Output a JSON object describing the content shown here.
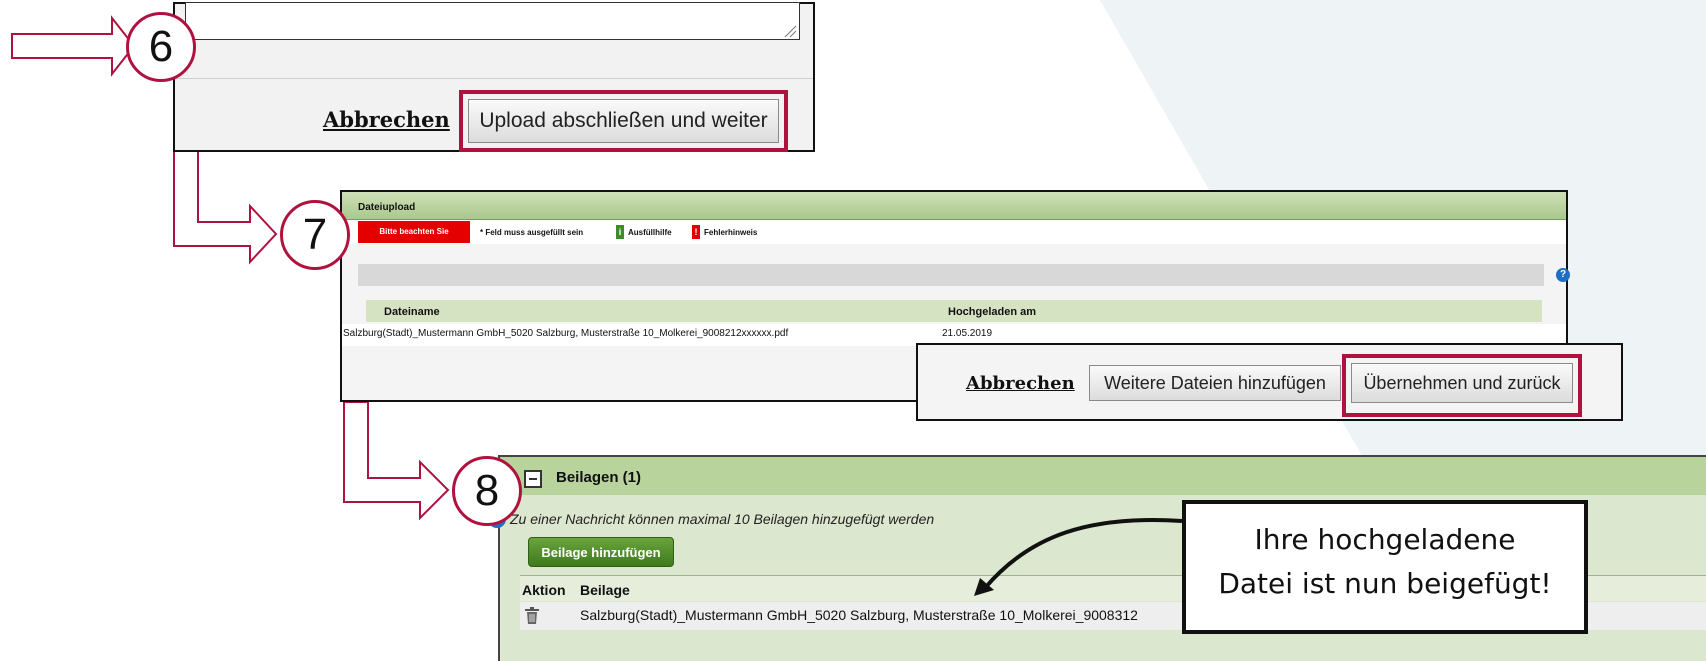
{
  "steps": {
    "step6": "6",
    "step7": "7",
    "step8": "8"
  },
  "panel6": {
    "cancel_label": "Abbrechen",
    "upload_label": "Upload abschließen und weiter"
  },
  "panel7": {
    "title": "Dateiupload",
    "notice_label": "Bitte beachten Sie",
    "legend_required": "* Feld muss ausgefüllt sein",
    "legend_help": "Ausfüllhilfe",
    "legend_error": "Fehlerhinweis",
    "help_icon": "question-circle-icon",
    "table": {
      "columns": [
        "Dateiname",
        "Hochgeladen am"
      ],
      "rows": [
        [
          "Salzburg(Stadt)_Mustermann GmbH_5020 Salzburg, Musterstraße 10_Molkerei_9008212xxxxxx.pdf",
          "21.05.2019"
        ]
      ]
    },
    "dialog": {
      "cancel_label": "Abbrechen",
      "add_more_label": "Weitere Dateien hinzufügen",
      "apply_label": "Übernehmen und zurück"
    }
  },
  "panel8": {
    "title": "Beilagen (1)",
    "info_text": "Zu einer Nachricht können maximal 10 Beilagen hinzugefügt werden",
    "add_button_label": "Beilage hinzufügen",
    "columns": [
      "Aktion",
      "Beilage"
    ],
    "rows": [
      {
        "action_icon": "trash-icon",
        "file": "Salzburg(Stadt)_Mustermann GmbH_5020 Salzburg, Musterstraße 10_Molkerei_9008312"
      }
    ]
  },
  "callout": {
    "line1": "Ihre hochgeladene",
    "line2": "Datei ist nun beigefügt!"
  },
  "colors": {
    "highlight": "#b0123f",
    "header_green": "#b8d39b",
    "button_green": "#4f8a2a",
    "notice_red": "#e40000",
    "background_shape": "#eef3f6"
  }
}
